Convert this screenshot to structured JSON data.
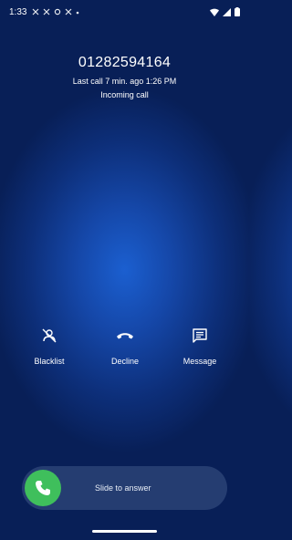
{
  "status_bar": {
    "time": "1:33",
    "icons_left": [
      "x-icon",
      "x-icon",
      "settings-icon",
      "x-icon",
      "dot-icon"
    ],
    "icons_right": [
      "wifi-icon",
      "signal-icon",
      "battery-icon"
    ]
  },
  "caller": {
    "number": "01282594164",
    "last_call": "Last call 7 min. ago 1:26 PM",
    "status": "Incoming call"
  },
  "actions": {
    "blacklist": "Blacklist",
    "decline": "Decline",
    "message": "Message"
  },
  "slider": {
    "label": "Slide to answer",
    "knob_color": "#3fbf5c"
  }
}
